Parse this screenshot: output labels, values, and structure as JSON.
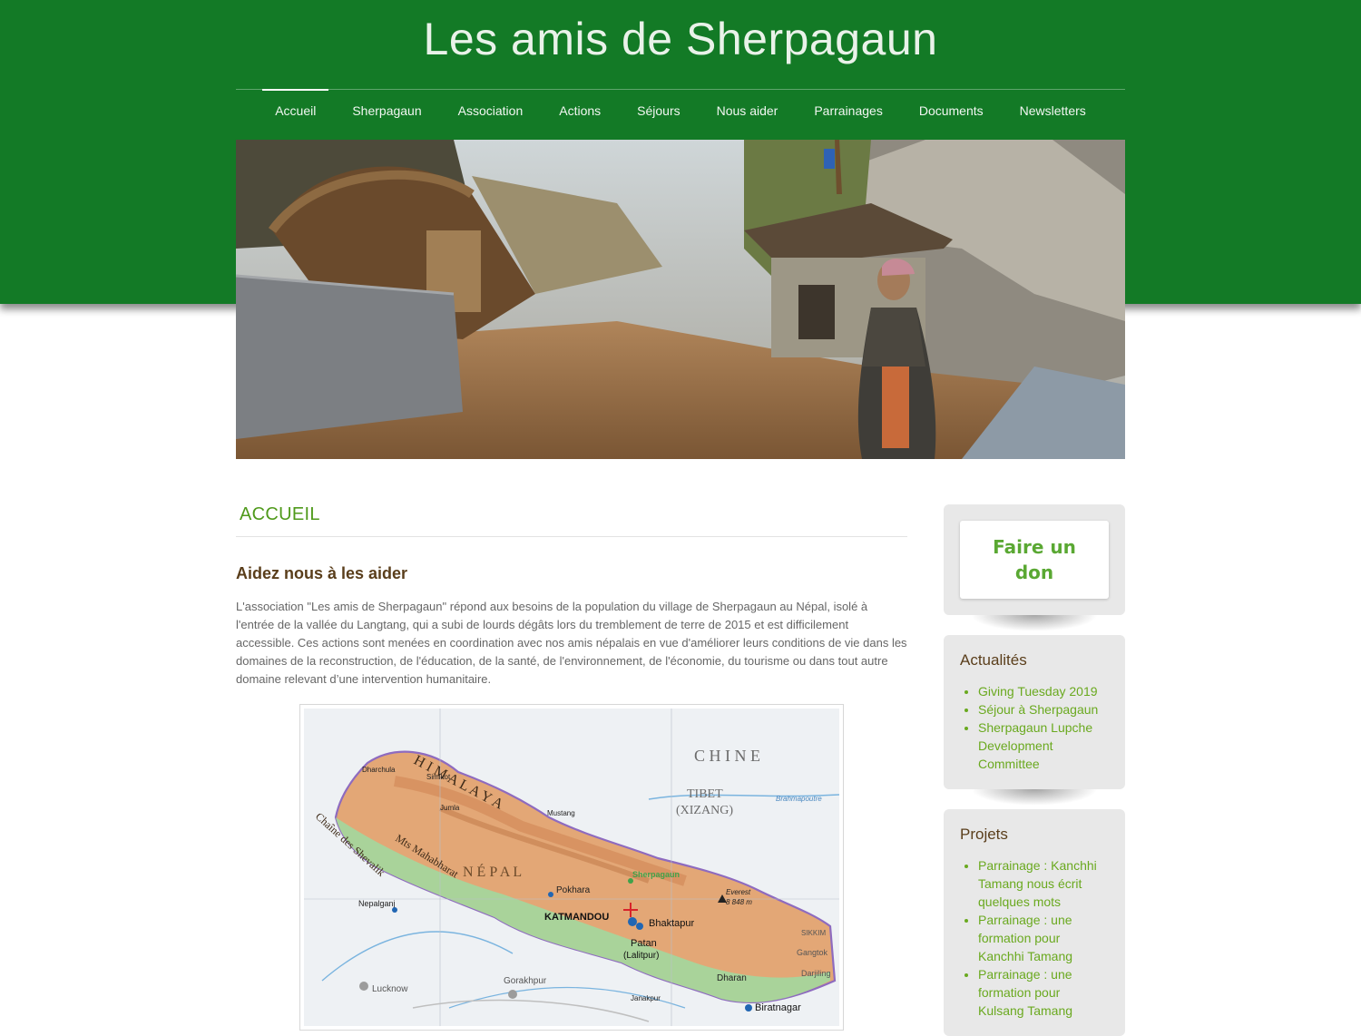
{
  "site": {
    "title": "Les amis de Sherpagaun"
  },
  "nav": {
    "items": [
      {
        "label": "Accueil"
      },
      {
        "label": "Sherpagaun"
      },
      {
        "label": "Association"
      },
      {
        "label": "Actions"
      },
      {
        "label": "Séjours"
      },
      {
        "label": "Nous aider"
      },
      {
        "label": "Parrainages"
      },
      {
        "label": "Documents"
      },
      {
        "label": "Newsletters"
      }
    ],
    "active": "Accueil"
  },
  "main": {
    "page_heading": "ACCUEIL",
    "subheading": "Aidez nous à les aider",
    "intro": "L'association \"Les amis de Sherpagaun\" répond aux besoins de la population du village de Sherpagaun au Népal, isolé à l'entrée de la vallée du Langtang, qui a subi de lourds dégâts lors du tremblement de terre de 2015 et est difficilement accessible. Ces actions sont menées en coordination avec nos amis népalais en vue d'améliorer leurs conditions de vie dans les domaines de la reconstruction, de l'éducation, de la santé, de l'environnement, de l'économie, du tourisme ou dans tout autre domaine relevant d’une intervention humanitaire."
  },
  "map": {
    "labels": {
      "chine": "C H I N E",
      "tibet": "TIBET",
      "xizang": "(XIZANG)",
      "nepal": "N É P A L",
      "himalaya": "H I M A L A Y A",
      "katmandou": "KATMANDOU",
      "sherpagaun": "Sherpagaun",
      "pokhara": "Pokhara",
      "bhaktapur": "Bhaktapur",
      "patan": "Patan",
      "lalitpur": "(Lalitpur)",
      "nepalganj": "Nepalganj",
      "gorakhpur": "Gorakhpur",
      "lucknow": "Lucknow",
      "biratnagar": "Biratnagar",
      "dharan": "Dharan",
      "everest": "Everest",
      "everest_alt": "8 848 m",
      "chevalik": "Chaîne des Shevalik",
      "mahabharat": "Mts Mahabharat",
      "mustang": "Mustang",
      "jumla": "Jumla",
      "simikot": "Simikot",
      "dharchula": "Dharchula",
      "janakpur": "Janakpur",
      "gangtok": "Gangtok",
      "darjiling": "Darjiling",
      "sikkim": "SIKKIM",
      "brahmapoutre": "Brahmapoutre"
    },
    "colors": {
      "land": "#e3a776",
      "lowland": "#a9d39a",
      "sea": "#eef1f4",
      "border": "#8e6bbf"
    }
  },
  "sidebar": {
    "donate_label": "Faire un don",
    "news": {
      "title": "Actualités",
      "items": [
        "Giving Tuesday 2019",
        "Séjour à Sherpagaun",
        "Sherpagaun Lupche Development Committee"
      ]
    },
    "projects": {
      "title": "Projets",
      "items": [
        "Parrainage : Kanchhi Tamang nous écrit quelques mots",
        "Parrainage : une formation pour Kanchhi Tamang",
        "Parrainage : une formation pour Kulsang Tamang"
      ]
    }
  },
  "colors": {
    "header_green": "#137a26",
    "link_green": "#6aa91f",
    "heading_brown": "#5a3e1b"
  }
}
